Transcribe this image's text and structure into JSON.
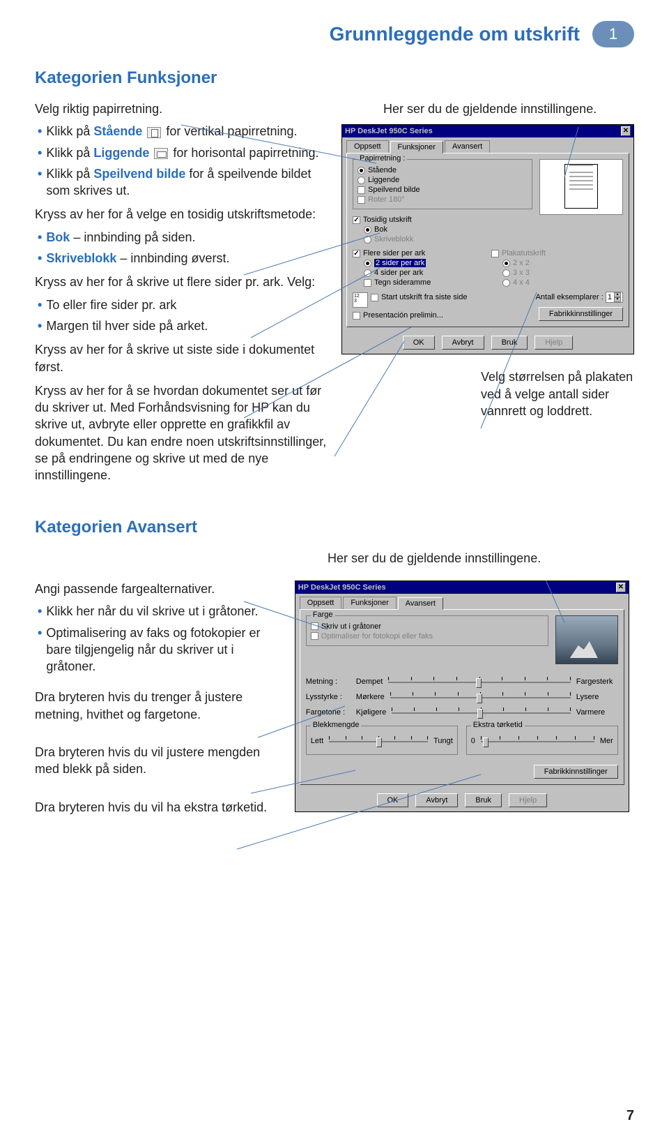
{
  "header": {
    "title": "Grunnleggende om utskrift",
    "chapter": "1"
  },
  "sec1": {
    "title": "Kategorien Funksjoner",
    "intro": "Velg riktig papirretning.",
    "b1a": "Klikk på ",
    "b1_term": "Stående",
    "b1b": " for vertikal papirretning.",
    "b2a": "Klikk på ",
    "b2_term": "Liggende",
    "b2b": " for horisontal papirretning.",
    "b3a": "Klikk på ",
    "b3_term": "Speilvend bilde",
    "b3b": " for å speilvende bildet som skrives ut.",
    "p2": "Kryss av her for å velge en tosidig utskriftsmetode:",
    "b4_term": "Bok",
    "b4_rest": " – innbinding på siden.",
    "b5_term": "Skriveblokk",
    "b5_rest": " – innbinding øverst.",
    "p3": "Kryss av her for å skrive ut flere sider pr. ark. Velg:",
    "b6": "To eller fire sider pr. ark",
    "b7": "Margen til hver side på arket.",
    "p4": "Kryss av her for å skrive ut siste side i dokumentet først.",
    "p5": "Kryss av her for å se hvordan dokumentet ser ut før du skriver ut. Med Forhåndsvisning for HP kan du skrive ut, avbryte eller opprette en grafikkfil av dokumentet. Du kan endre noen utskriftsinnstillinger, se på endringene og skrive ut med de nye innstillingene.",
    "right_caption1": "Her ser du de gjeldende innstillingene.",
    "right_caption2": "Velg størrelsen på plakaten ved å velge antall sider vannrett og loddrett."
  },
  "dialog1": {
    "title": "HP DeskJet 950C Series",
    "tabs": {
      "t1": "Oppsett",
      "t2": "Funksjoner",
      "t3": "Avansert"
    },
    "grp_orient": "Papirretning :",
    "r_staende": "Stående",
    "r_liggende": "Liggende",
    "c_speilvend": "Speilvend bilde",
    "c_roter": "Roter 180°",
    "c_tosidig": "Tosidig utskrift",
    "r_bok": "Bok",
    "r_skriveblokk": "Skriveblokk",
    "c_flere": "Flere sider per ark",
    "r_2sider": "2 sider per ark",
    "r_4sider": "4 sider per ark",
    "c_tegn": "Tegn sideramme",
    "c_plakat": "Plakatutskrift",
    "r_2x2": "2 x 2",
    "r_3x3": "3 x 3",
    "r_4x4": "4 x 4",
    "c_start": "Start utskrift fra siste side",
    "c_presentacion": "Presentación prelimin...",
    "lbl_antall": "Antall eksemplarer :",
    "antall_val": "1",
    "btn_fabrikk": "Fabrikkinnstillinger",
    "btn_ok": "OK",
    "btn_avbryt": "Avbryt",
    "btn_bruk": "Bruk",
    "btn_hjelp": "Hjelp"
  },
  "sec2": {
    "title": "Kategorien Avansert",
    "right_caption1": "Her ser du de gjeldende innstillingene.",
    "p1": "Angi passende fargealternativer.",
    "b1": "Klikk her når du vil skrive ut i gråtoner.",
    "b2": "Optimalisering av faks og fotokopier er bare tilgjengelig når du skriver ut i gråtoner.",
    "p2": "Dra bryteren hvis du trenger å justere metning, hvithet og fargetone.",
    "p3": "Dra bryteren hvis du vil justere mengden med blekk på siden.",
    "p4": "Dra bryteren hvis du vil ha ekstra tørketid."
  },
  "dialog2": {
    "title": "HP DeskJet 950C Series",
    "tabs": {
      "t1": "Oppsett",
      "t2": "Funksjoner",
      "t3": "Avansert"
    },
    "grp_farge": "Farge",
    "c_gratoner": "Skriv ut i gråtoner",
    "c_optimal": "Optimaliser for fotokopi eller faks",
    "lbl_metning": "Metning :",
    "end_dempet": "Dempet",
    "end_fargesterk": "Fargesterk",
    "lbl_lysstyrke": "Lysstyrke :",
    "end_morkere": "Mørkere",
    "end_lysere": "Lysere",
    "lbl_fargetone": "Fargetone :",
    "end_kjoligere": "Kjøligere",
    "end_varmere": "Varmere",
    "grp_blekk": "Blekkmengde",
    "end_lett": "Lett",
    "end_tungt": "Tungt",
    "grp_torke": "Ekstra tørketid",
    "end_0": "0",
    "end_mer": "Mer",
    "btn_fabrikk": "Fabrikkinnstillinger",
    "btn_ok": "OK",
    "btn_avbryt": "Avbryt",
    "btn_bruk": "Bruk",
    "btn_hjelp": "Hjelp"
  },
  "page_num": "7"
}
